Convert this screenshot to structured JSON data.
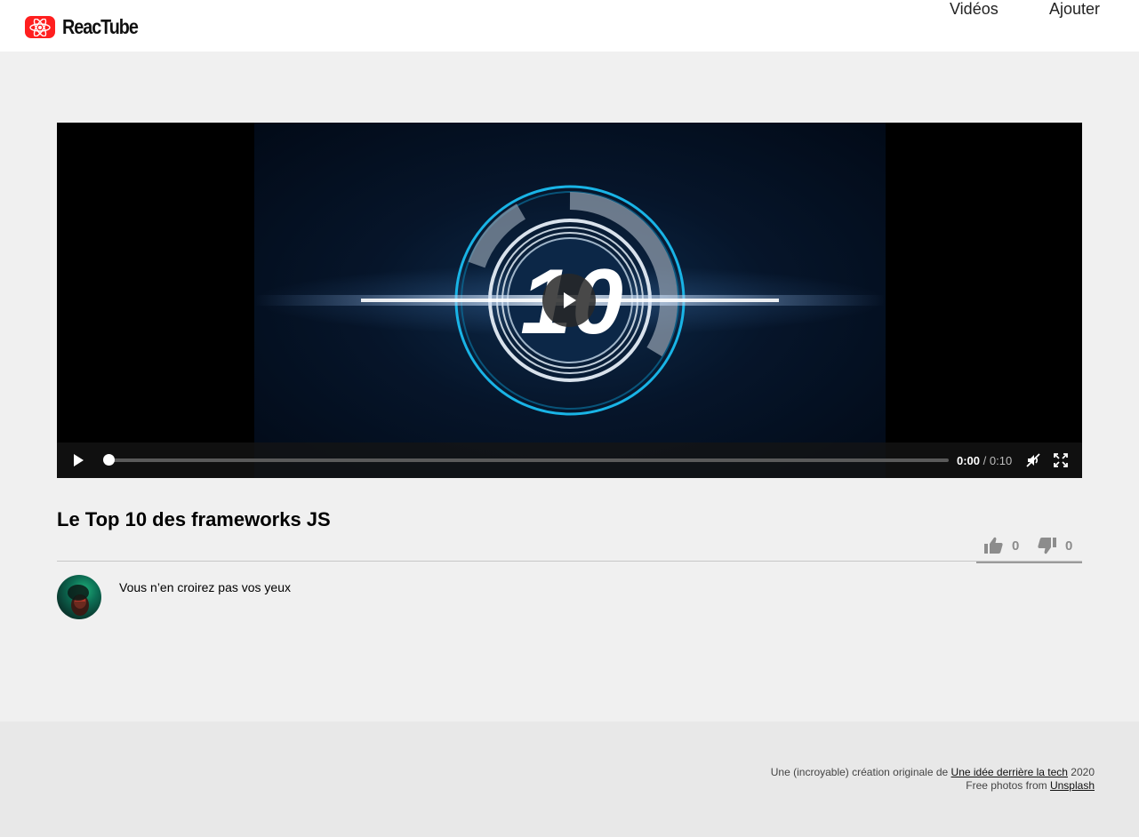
{
  "brand": {
    "name": "ReacTube",
    "accent": "#ff1f1f"
  },
  "nav": [
    {
      "label": "Vidéos"
    },
    {
      "label": "Ajouter"
    }
  ],
  "video": {
    "thumbnail_text": "10",
    "current_time": "0:00",
    "separator": " / ",
    "duration": "0:10",
    "progress": 0
  },
  "details": {
    "title": "Le Top 10 des frameworks JS",
    "likes": "0",
    "dislikes": "0",
    "description": "Vous n’en croirez pas vos yeux"
  },
  "footer": {
    "line1_prefix": "Une (incroyable) création originale de ",
    "line1_link": "Une idée derrière la tech",
    "line1_suffix": " 2020",
    "line2_prefix": "Free photos from ",
    "line2_link": "Unsplash"
  },
  "icons": {
    "logo": "react-atom-icon",
    "play": "play-icon",
    "mute": "muted-speaker-icon",
    "fullscreen": "fullscreen-icon",
    "like": "thumbs-up-icon",
    "dislike": "thumbs-down-icon"
  }
}
